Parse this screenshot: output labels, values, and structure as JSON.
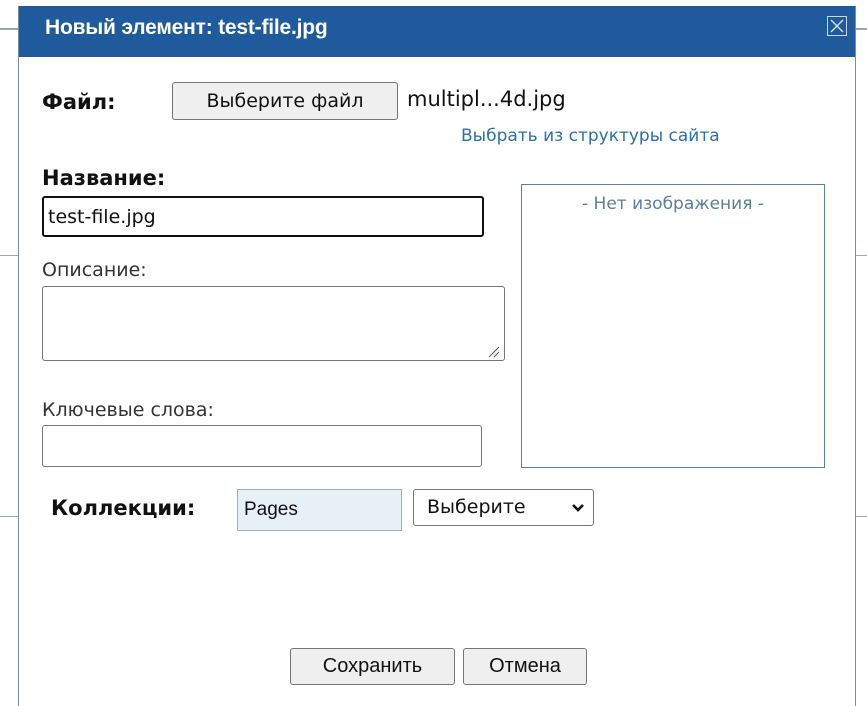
{
  "dialog": {
    "title": "Новый элемент: test-file.jpg",
    "close_icon": "close-icon"
  },
  "file": {
    "label": "Файл:",
    "choose_button": "Выберите файл",
    "file_name": "multipl...4d.jpg",
    "site_structure_link": "Выбрать из структуры сайта"
  },
  "name": {
    "label": "Название:",
    "value": "test-file.jpg"
  },
  "description": {
    "label": "Описание:",
    "value": ""
  },
  "keywords": {
    "label": "Ключевые слова:",
    "value": ""
  },
  "preview": {
    "text": "- Нет изображения -"
  },
  "collections": {
    "label": "Коллекции:",
    "selected": "Pages",
    "select_label": "Выберите"
  },
  "actions": {
    "save": "Сохранить",
    "cancel": "Отмена"
  },
  "colors": {
    "titlebar": "#1f5b9c",
    "link": "#2f6fa8",
    "preview_text": "#5b7e9c"
  }
}
